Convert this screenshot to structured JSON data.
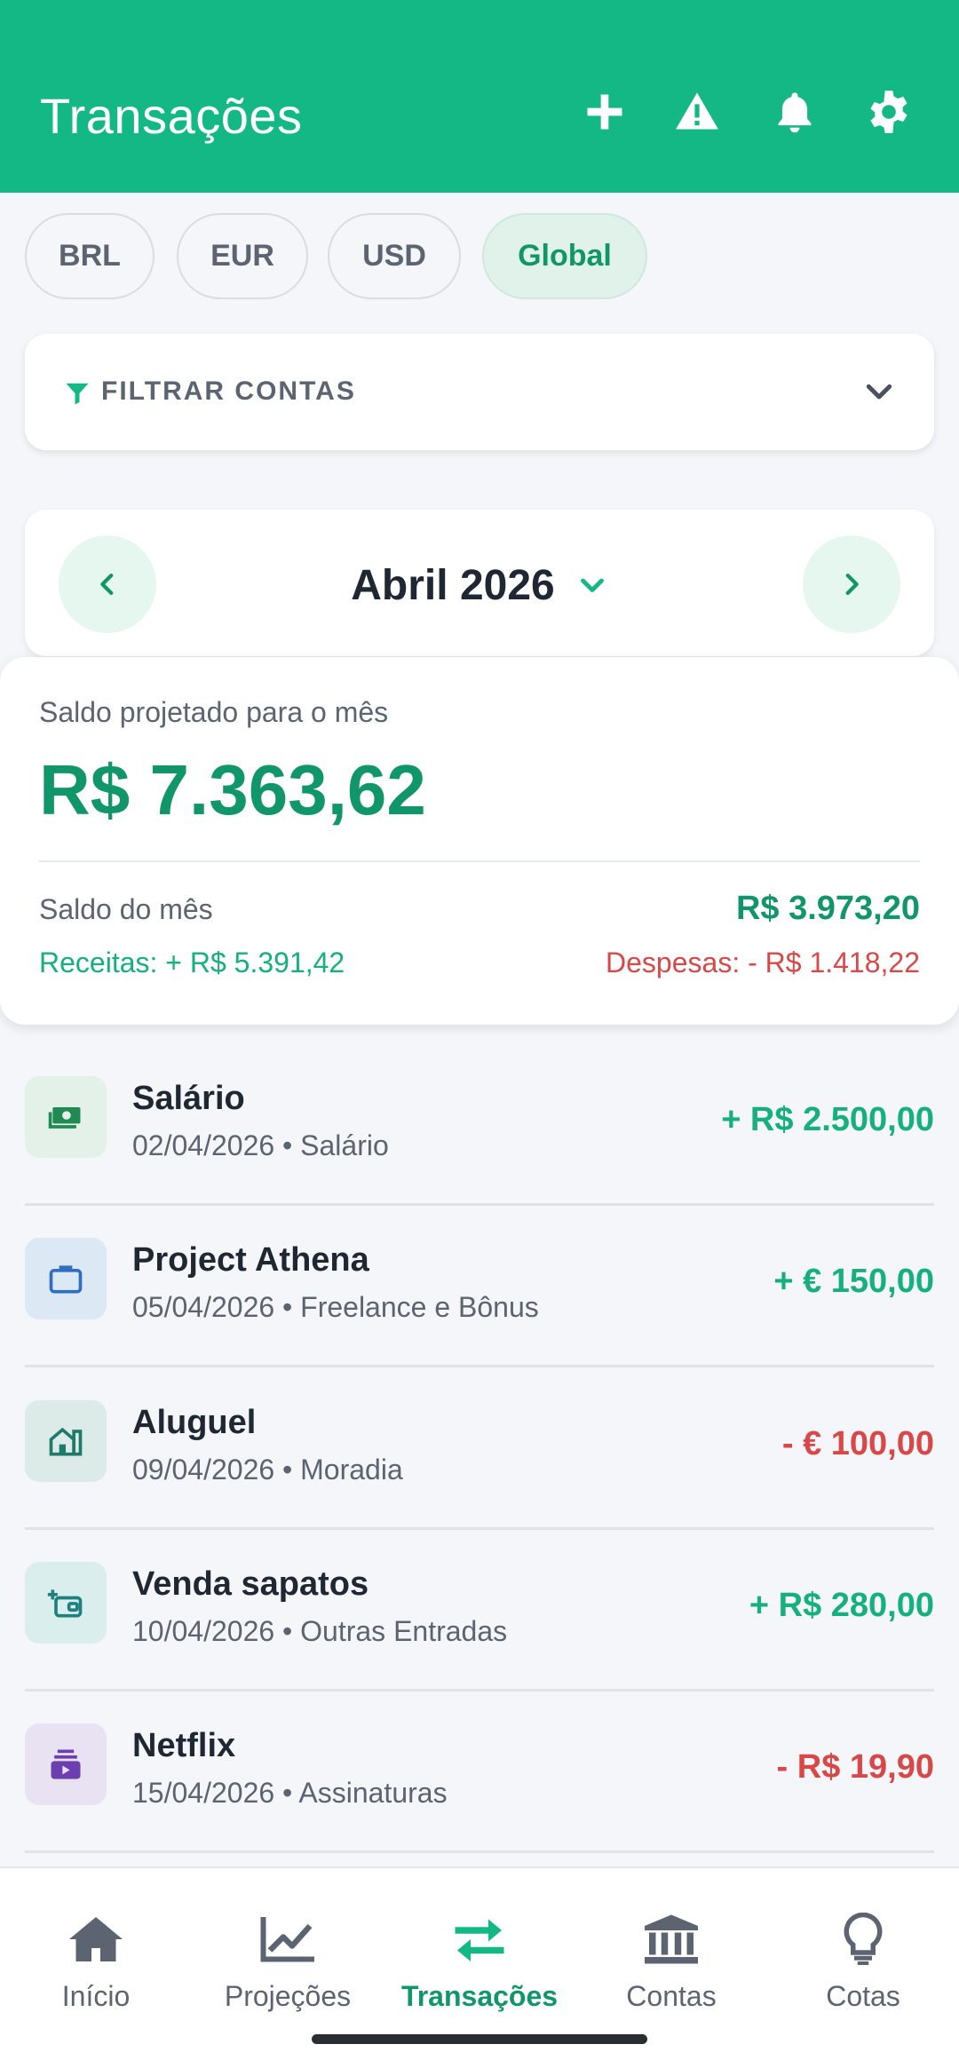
{
  "header": {
    "title": "Transações",
    "icons": [
      "plus-icon",
      "warning-icon",
      "bell-icon",
      "gear-icon"
    ]
  },
  "currencies": [
    {
      "label": "BRL",
      "active": false
    },
    {
      "label": "EUR",
      "active": false
    },
    {
      "label": "USD",
      "active": false
    },
    {
      "label": "Global",
      "active": true
    }
  ],
  "filter": {
    "label": "FILTRAR CONTAS"
  },
  "month": {
    "label": "Abril 2026"
  },
  "balance": {
    "caption": "Saldo projetado para o mês",
    "amount": "R$ 7.363,62",
    "month_label": "Saldo do mês",
    "month_value": "R$ 3.973,20",
    "receitas": "Receitas: + R$ 5.391,42",
    "despesas": "Despesas: - R$ 1.418,22"
  },
  "transactions": [
    {
      "title": "Salário",
      "subtitle": "02/04/2026 • Salário",
      "amount": "+ R$ 2.500,00",
      "type": "income",
      "icon": "money-icon"
    },
    {
      "title": "Project Athena",
      "subtitle": "05/04/2026 • Freelance e Bônus",
      "amount": "+ € 150,00",
      "type": "income",
      "icon": "briefcase-icon"
    },
    {
      "title": "Aluguel",
      "subtitle": "09/04/2026 • Moradia",
      "amount": "- € 100,00",
      "type": "expense",
      "icon": "house-icon"
    },
    {
      "title": "Venda sapatos",
      "subtitle": "10/04/2026 • Outras Entradas",
      "amount": "+ R$ 280,00",
      "type": "income",
      "icon": "wallet-add-icon"
    },
    {
      "title": "Netflix",
      "subtitle": "15/04/2026 • Assinaturas",
      "amount": "- R$ 19,90",
      "type": "expense",
      "icon": "subscription-icon"
    }
  ],
  "nav": [
    {
      "label": "Início",
      "icon": "home-icon",
      "active": false
    },
    {
      "label": "Projeções",
      "icon": "chart-line-icon",
      "active": false
    },
    {
      "label": "Transações",
      "icon": "transfer-icon",
      "active": true
    },
    {
      "label": "Contas",
      "icon": "bank-icon",
      "active": false
    },
    {
      "label": "Cotas",
      "icon": "lightbulb-icon",
      "active": false
    }
  ],
  "colors": {
    "brand": "#14b885",
    "positive": "#16b07c",
    "negative": "#d94848"
  }
}
